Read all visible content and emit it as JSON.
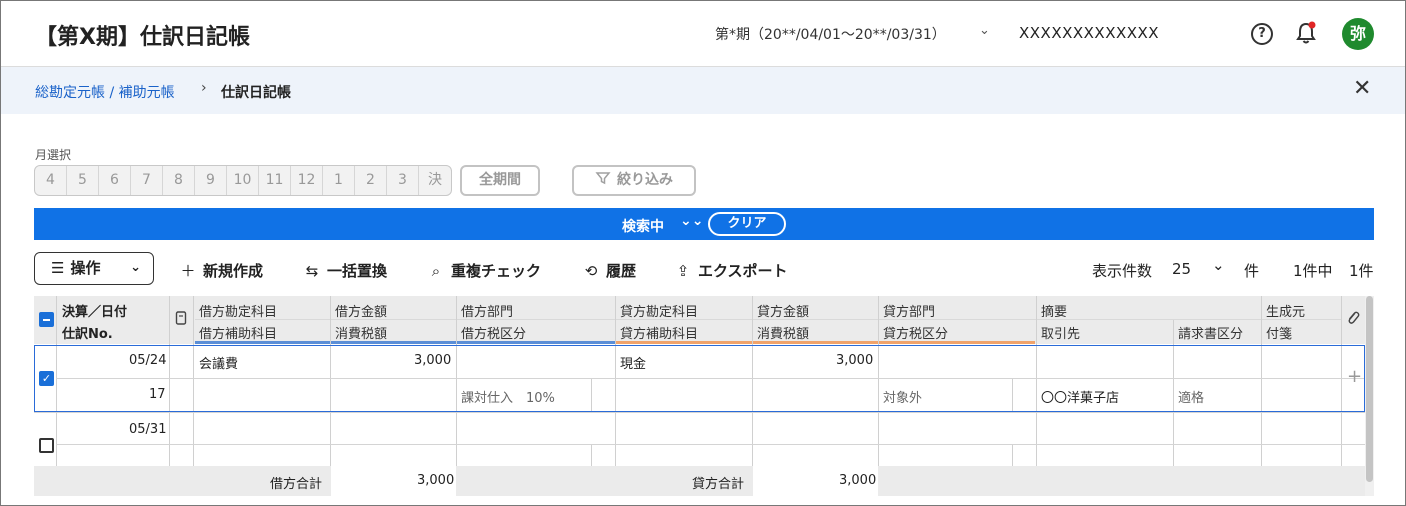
{
  "header": {
    "title": "【第X期】仕訳日記帳",
    "period": "第*期（20**/04/01〜20**/03/31）",
    "company": "XXXXXXXXXXXXX",
    "avatar": "弥"
  },
  "breadcrumb": {
    "parent": "総勘定元帳 / 補助元帳",
    "separator": "›",
    "current": "仕訳日記帳"
  },
  "month_select": {
    "label": "月選択",
    "months": [
      "4",
      "5",
      "6",
      "7",
      "8",
      "9",
      "10",
      "11",
      "12",
      "1",
      "2",
      "3",
      "決"
    ],
    "all_period": "全期間",
    "filter": "絞り込み"
  },
  "search": {
    "status": "検索中",
    "clear": "クリア"
  },
  "toolbar": {
    "operation": "操作",
    "new": "新規作成",
    "bulk_replace": "一括置換",
    "dup_check": "重複チェック",
    "history": "履歴",
    "export": "エクスポート",
    "display_count_label": "表示件数",
    "display_count": "25",
    "unit": "件",
    "range": "1件中",
    "total": "1件"
  },
  "table": {
    "headers_top": {
      "date": "決算／日付",
      "debit_account": "借方勘定科目",
      "debit_amount": "借方金額",
      "debit_dept": "借方部門",
      "credit_account": "貸方勘定科目",
      "credit_amount": "貸方金額",
      "credit_dept": "貸方部門",
      "summary": "摘要",
      "source": "生成元"
    },
    "headers_bottom": {
      "entry_no": "仕訳No.",
      "debit_sub": "借方補助科目",
      "debit_tax": "消費税額",
      "debit_tax_cat": "借方税区分",
      "credit_sub": "貸方補助科目",
      "credit_tax": "消費税額",
      "credit_tax_cat": "貸方税区分",
      "partner": "取引先",
      "invoice_cat": "請求書区分",
      "tag": "付箋"
    },
    "rows": [
      {
        "date": "05/24",
        "entry_no": "17",
        "debit_account": "会議費",
        "debit_amount": "3,000",
        "debit_tax_cat": "課対仕入　10%",
        "credit_account": "現金",
        "credit_amount": "3,000",
        "credit_tax_cat": "対象外",
        "partner": "〇〇洋菓子店",
        "invoice_cat": "適格",
        "selected": true
      },
      {
        "date": "05/31",
        "selected": false
      }
    ],
    "totals": {
      "debit_label": "借方合計",
      "debit_value": "3,000",
      "credit_label": "貸方合計",
      "credit_value": "3,000"
    }
  }
}
